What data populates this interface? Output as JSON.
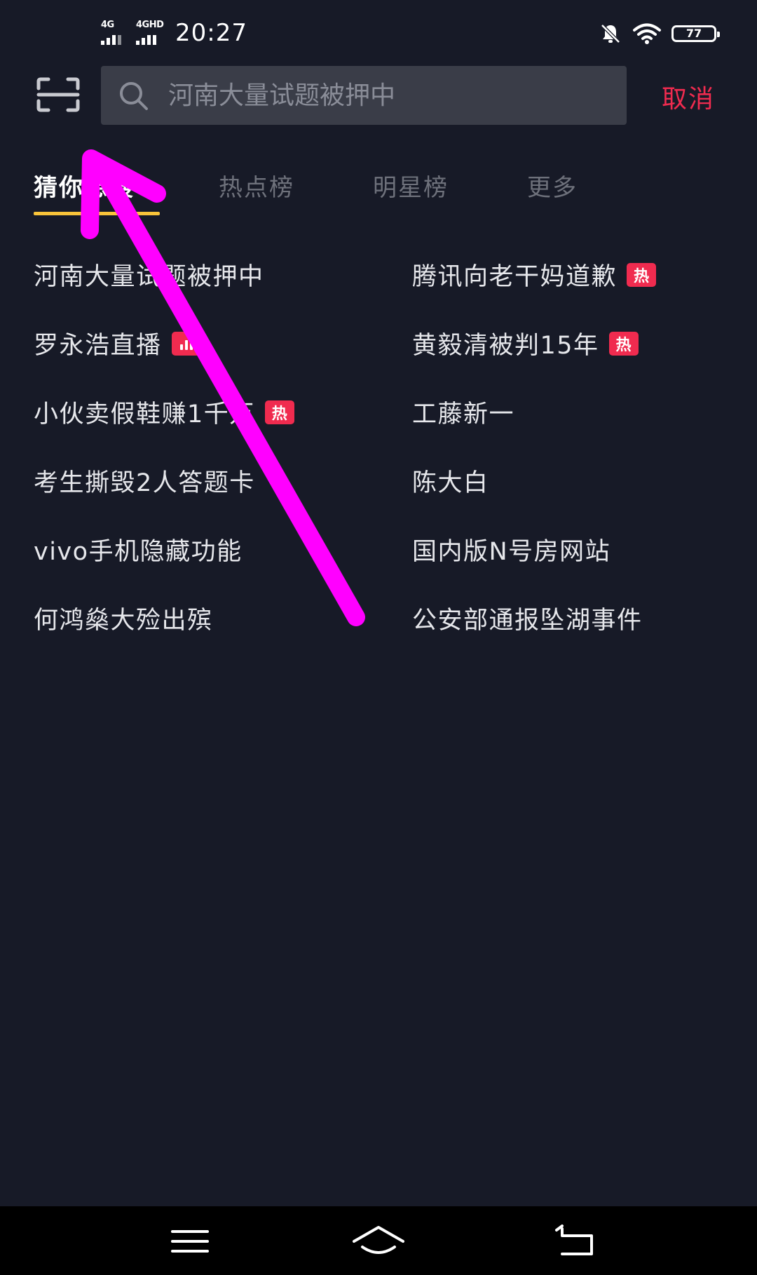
{
  "status_bar": {
    "signal1_label": "4G",
    "signal2_label": "4GHD",
    "time": "20:27",
    "battery_level": "77",
    "icons": [
      "mute-bell-icon",
      "wifi-icon",
      "battery-icon"
    ]
  },
  "header": {
    "search_placeholder": "河南大量试题被押中",
    "cancel_label": "取消",
    "icons": [
      "scan-icon",
      "search-icon"
    ]
  },
  "tabs": [
    {
      "label": "猜你想搜",
      "active": true
    },
    {
      "label": "热点榜",
      "active": false
    },
    {
      "label": "明星榜",
      "active": false
    },
    {
      "label": "更多",
      "active": false
    }
  ],
  "suggestions": [
    {
      "text": "河南大量试题被押中",
      "badge": ""
    },
    {
      "text": "腾讯向老干妈道歉",
      "badge": "热"
    },
    {
      "text": "罗永浩直播",
      "badge": "live"
    },
    {
      "text": "黄毅清被判15年",
      "badge": "热"
    },
    {
      "text": "小伙卖假鞋赚1千万",
      "badge": "热"
    },
    {
      "text": "工藤新一",
      "badge": ""
    },
    {
      "text": "考生撕毁2人答题卡",
      "badge": ""
    },
    {
      "text": "陈大白",
      "badge": ""
    },
    {
      "text": "vivo手机隐藏功能",
      "badge": ""
    },
    {
      "text": "国内版N号房网站",
      "badge": ""
    },
    {
      "text": "何鸿燊大殓出殡",
      "badge": ""
    },
    {
      "text": "公安部通报坠湖事件",
      "badge": ""
    }
  ],
  "hot_badge_label": "热",
  "nav_bar": {
    "icons": [
      "menu-icon",
      "home-icon",
      "back-icon"
    ]
  },
  "colors": {
    "background": "#171a27",
    "search_box": "#3a3d48",
    "accent_red": "#f02b4f",
    "tab_underline": "#f9c43a",
    "annotation": "#ff00ff"
  }
}
